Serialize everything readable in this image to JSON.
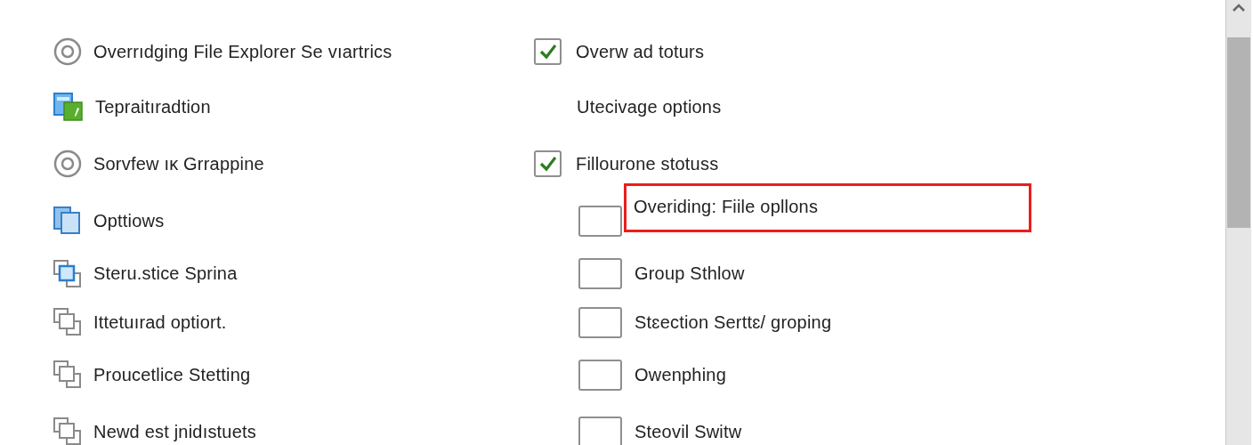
{
  "left_items": [
    {
      "kind": "radio",
      "label": "Overrıdging File Explorer Se vıartrics"
    },
    {
      "kind": "app",
      "label": "Tepraitıradtion"
    },
    {
      "kind": "radio",
      "label": "Sorvfew ıᴋ Grrappine"
    },
    {
      "kind": "window",
      "label": "Opttiows"
    },
    {
      "kind": "stack-blue",
      "label": "Steru.stice Sprina"
    },
    {
      "kind": "stack",
      "label": "Ittetuırad optiort."
    },
    {
      "kind": "stack",
      "label": "Proucetlice Stetting"
    },
    {
      "kind": "stack",
      "label": "Newd est jnidıstuets"
    }
  ],
  "right_items": [
    {
      "kind": "checkbox",
      "checked": true,
      "highlighted": false,
      "label": "Overw ad toturs"
    },
    {
      "kind": "heading",
      "label": "Utecivage options"
    },
    {
      "kind": "checkbox",
      "checked": true,
      "highlighted": false,
      "label": "Fillourone stotuss"
    },
    {
      "kind": "checkbox",
      "checked": false,
      "highlighted": true,
      "label": "Overiding: Fiile opllons"
    },
    {
      "kind": "checkbox",
      "checked": false,
      "highlighted": false,
      "label": "Group Sthlow"
    },
    {
      "kind": "checkbox",
      "checked": false,
      "highlighted": false,
      "label": "Stɛection Serttɛ/ groping"
    },
    {
      "kind": "checkbox",
      "checked": false,
      "highlighted": false,
      "label": "Owenphing"
    },
    {
      "kind": "checkbox",
      "checked": false,
      "highlighted": false,
      "label": "Steovil Switw"
    }
  ]
}
